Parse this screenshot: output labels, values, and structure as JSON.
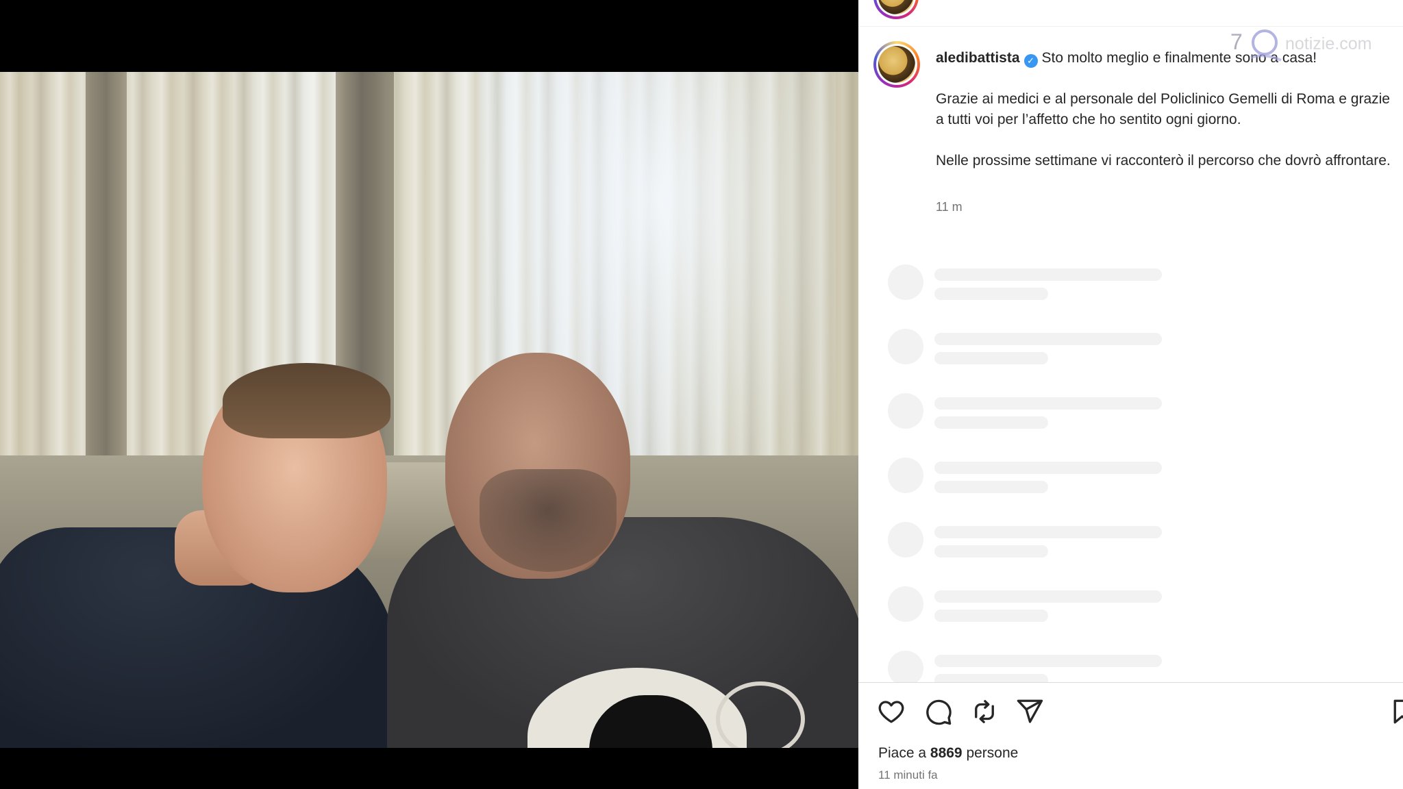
{
  "post": {
    "username": "aledibattista",
    "caption_first_line": "Sto molto meglio e finalmente sono a casa!",
    "caption_para_2": "Grazie ai medici e al personale del Policlinico Gemelli di Roma e grazie a tutti voi per l’affetto che ho sentito ogni giorno.",
    "caption_para_3": "Nelle prossime settimane vi racconterò il percorso che dovrò affrontare.",
    "caption_time": "11 m",
    "likes_label": "Piace a",
    "likes_count": "8869",
    "likes_suffix": "persone",
    "post_date": "11 minuti fa",
    "verified": true
  },
  "watermark": {
    "logo_glyph": "7",
    "text": "notizie.com"
  },
  "icons": [
    "heart-icon",
    "comment-icon",
    "repost-icon",
    "share-icon",
    "bookmark-icon",
    "verified-badge-icon"
  ],
  "skeleton_comment_rows": 7,
  "colors": {
    "text": "#262626",
    "secondary_text": "#737373",
    "verified_blue": "#3897f0",
    "skeleton": "#f2f2f2"
  }
}
